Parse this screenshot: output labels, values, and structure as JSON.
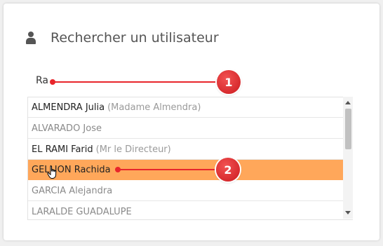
{
  "panel": {
    "title": "Rechercher un utilisateur",
    "icon": "user-icon"
  },
  "search": {
    "value": "Ra"
  },
  "results": [
    {
      "name": "ALMENDRA Julia",
      "detail": "(Madame Almendra)",
      "muted": false,
      "selected": false
    },
    {
      "name": "ALVARADO Jose",
      "detail": "",
      "muted": true,
      "selected": false
    },
    {
      "name": "EL RAMI Farid",
      "detail": "(Mr le Directeur)",
      "muted": false,
      "selected": false
    },
    {
      "name": "GELLION Rachida",
      "detail": "",
      "muted": false,
      "selected": true
    },
    {
      "name": "GARCIA Alejandra",
      "detail": "",
      "muted": true,
      "selected": false
    },
    {
      "name": "LARALDE GUADALUPE",
      "detail": "",
      "muted": true,
      "selected": false
    }
  ],
  "callouts": [
    {
      "number": "1"
    },
    {
      "number": "2"
    }
  ],
  "colors": {
    "selected_row": "#ffa75a",
    "callout": "#e8262b"
  }
}
